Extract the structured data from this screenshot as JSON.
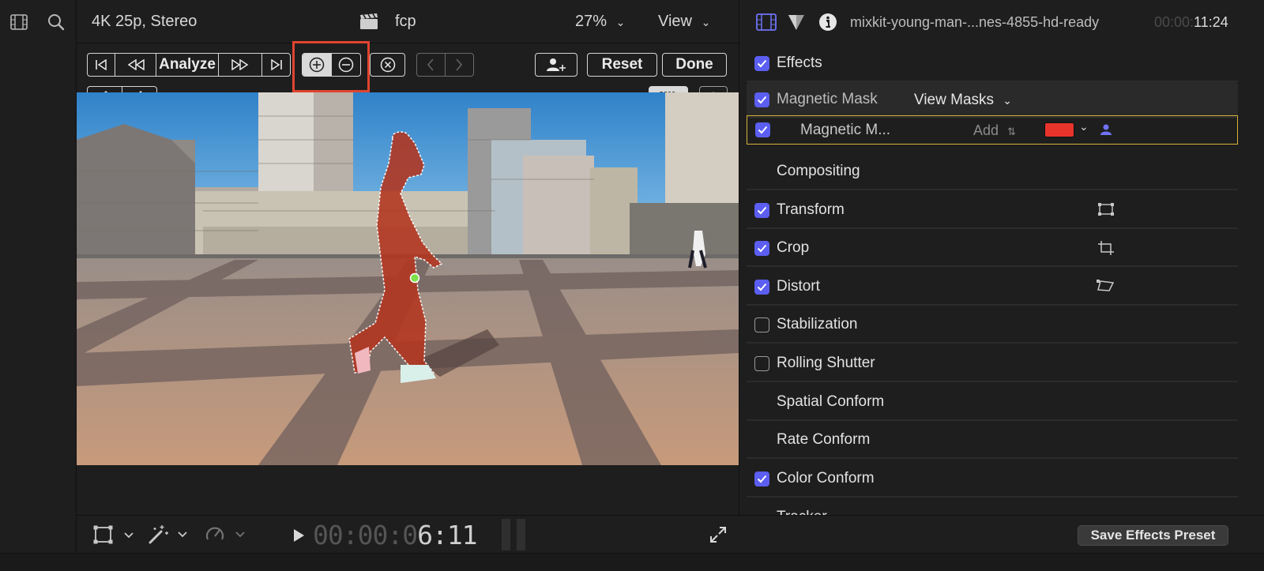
{
  "viewer": {
    "format_label": "4K 25p, Stereo",
    "project_name": "fcp",
    "zoom_label": "27%",
    "view_menu_label": "View",
    "toolbar": {
      "analyze_label": "Analyze",
      "reset_label": "Reset",
      "done_label": "Done"
    },
    "timecode_dim": "00:00:0",
    "timecode_live": "6:11"
  },
  "inspector": {
    "clip_name": "mixkit-young-man-...nes-4855-hd-ready",
    "time_dim": "00:00:",
    "time_live": "11:24",
    "rows": [
      {
        "label": "Effects",
        "checked": true
      },
      {
        "label": "Magnetic Mask",
        "checked": true,
        "view_masks_label": "View Masks"
      },
      {
        "label": "Magnetic M...",
        "checked": true,
        "mode_label": "Add",
        "swatch_color": "#e8342a"
      },
      {
        "label": "Compositing",
        "checked": null
      },
      {
        "label": "Transform",
        "checked": true
      },
      {
        "label": "Crop",
        "checked": true
      },
      {
        "label": "Distort",
        "checked": true
      },
      {
        "label": "Stabilization",
        "checked": false
      },
      {
        "label": "Rolling Shutter",
        "checked": false
      },
      {
        "label": "Spatial Conform",
        "checked": null
      },
      {
        "label": "Rate Conform",
        "checked": null
      },
      {
        "label": "Color Conform",
        "checked": true
      },
      {
        "label": "Tracker",
        "checked": null
      }
    ],
    "save_preset_label": "Save Effects Preset"
  },
  "colors": {
    "accent": "#5b5ef0",
    "highlight": "#e0442f",
    "selected_row_border": "#d9b23a",
    "mask_overlay": "#b3351f"
  }
}
